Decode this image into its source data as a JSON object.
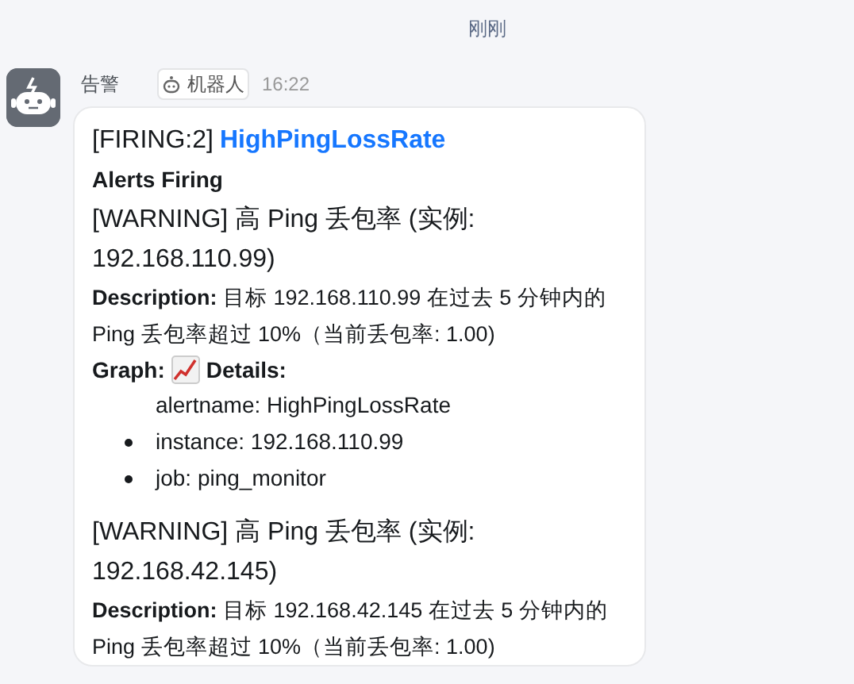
{
  "time_divider": "刚刚",
  "message": {
    "sender": "告警",
    "tag": "机器人",
    "time": "16:22",
    "title_prefix": "[FIRING:2]",
    "title_link": "HighPingLossRate",
    "heading": "Alerts Firing",
    "alerts": [
      {
        "summary": "[WARNING] 高 Ping 丢包率 (实例: 192.168.110.99)",
        "description_label": "Description:",
        "description": "目标 192.168.110.99 在过去 5 分钟内的 Ping 丢包率超过 10%（当前丢包率: 1.00)",
        "graph_label": "Graph:",
        "details_label": "Details:",
        "details": [
          {
            "text": "alertname: HighPingLossRate",
            "bulleted": false
          },
          {
            "text": "instance: 192.168.110.99",
            "bulleted": true
          },
          {
            "text": "job: ping_monitor",
            "bulleted": true
          }
        ]
      },
      {
        "summary": "[WARNING] 高 Ping 丢包率 (实例: 192.168.42.145)",
        "description_label": "Description:",
        "description": "目标 192.168.42.145 在过去 5 分钟内的 Ping 丢包率超过 10%（当前丢包率: 1.00)"
      }
    ]
  }
}
